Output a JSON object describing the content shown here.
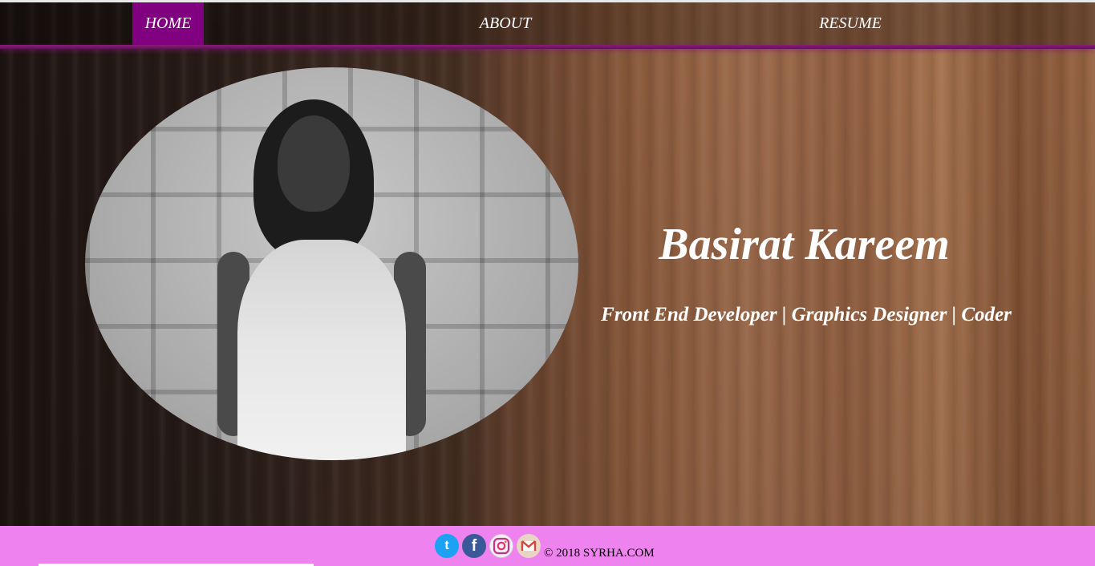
{
  "nav": {
    "items": [
      {
        "label": "HOME",
        "active": true
      },
      {
        "label": "ABOUT",
        "active": false
      },
      {
        "label": "RESUME",
        "active": false
      }
    ],
    "active_color": "#800080"
  },
  "hero": {
    "name": "Basirat Kareem",
    "tagline": "Front End Developer | Graphics Designer | Coder",
    "photo_icon": "profile-photo"
  },
  "footer": {
    "background": "#ee82ee",
    "social": [
      {
        "name": "twitter-icon",
        "glyph": "t"
      },
      {
        "name": "facebook-icon",
        "glyph": "f"
      },
      {
        "name": "instagram-icon",
        "glyph": "◎"
      },
      {
        "name": "gmail-icon",
        "glyph": "M"
      }
    ],
    "copyright": "© 2018 SYRHA.COM"
  }
}
